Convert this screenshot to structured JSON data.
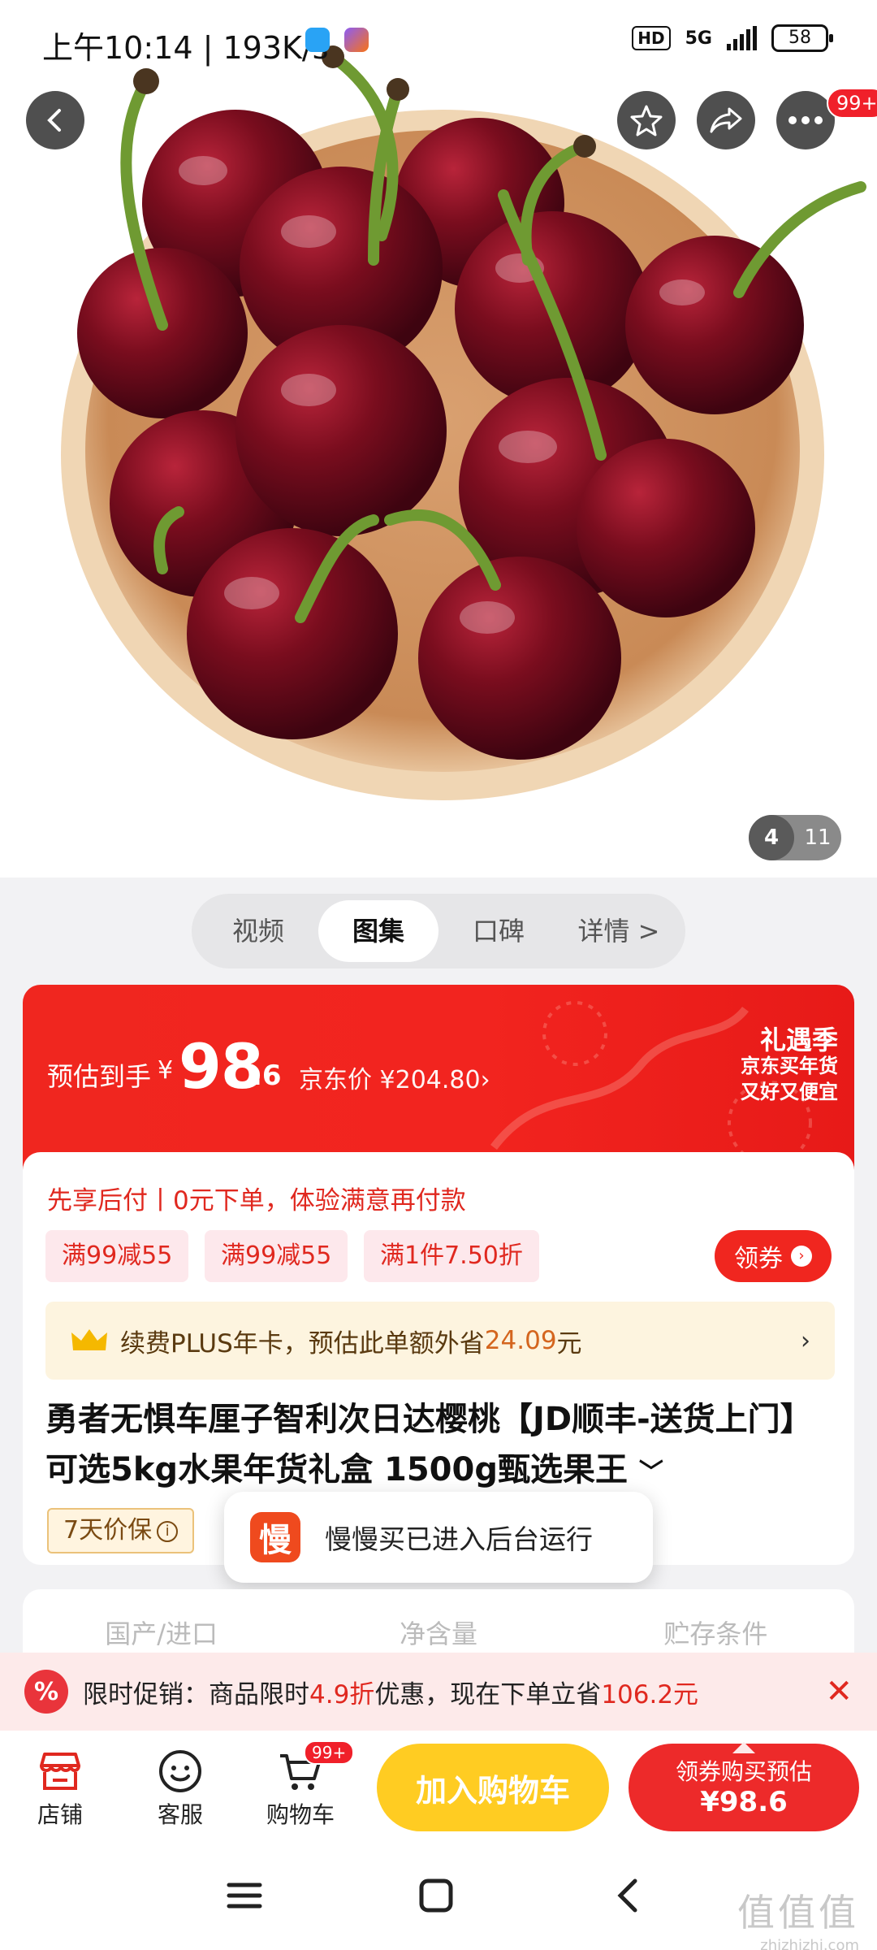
{
  "status_bar": {
    "time": "上午10:14 | 193K/s",
    "hd": "HD",
    "network": "5G",
    "battery": "58"
  },
  "header": {
    "more_badge": "99+"
  },
  "gallery": {
    "current": "4",
    "total": "11"
  },
  "tabs": [
    {
      "label": "视频",
      "active": false
    },
    {
      "label": "图集",
      "active": true
    },
    {
      "label": "口碑",
      "active": false
    },
    {
      "label": "详情 >",
      "active": false
    }
  ],
  "price": {
    "label": "预估到手",
    "currency": "¥",
    "big": "98",
    "decimal": ".6",
    "jd_price": "京东价 ¥204.80›",
    "campaign_title": "礼遇季",
    "campaign_line1": "京东买年货",
    "campaign_line2": "又好又便宜"
  },
  "pay_later": "先享后付丨0元下单，体验满意再付款",
  "coupons": [
    "满99减55",
    "满99减55",
    "满1件7.50折"
  ],
  "get_coupon": "领券",
  "plus": {
    "text_pre": "续费PLUS年卡，预估此单额外省",
    "amount": "24.09",
    "text_post": "元"
  },
  "product_title": "勇者无惧车厘子智利次日达樱桃【JD顺丰-送货上门】可选5kg水果年货礼盒 1500g甄选果王",
  "warranty": "7天价保",
  "toast": {
    "icon_text": "慢",
    "text": "慢慢买已进入后台运行"
  },
  "specs": [
    "国产/进口",
    "净含量",
    "贮存条件"
  ],
  "promo": {
    "pre": "限时促销：商品限时",
    "discount": "4.9折",
    "mid": "优惠，现在下单立省",
    "save": "106.2元"
  },
  "bottom_nav": {
    "store": "店铺",
    "service": "客服",
    "cart": "购物车",
    "cart_badge": "99+"
  },
  "buttons": {
    "add_cart": "加入购物车",
    "buy_line1": "领券购买预估",
    "buy_line2": "¥98.6"
  },
  "watermark": {
    "line1": "值值值",
    "line2": "zhizhizhi.com"
  },
  "colors": {
    "brand_red": "#f0261f",
    "cart_yellow": "#ffcc22",
    "plus_gold": "#fdf4df"
  }
}
